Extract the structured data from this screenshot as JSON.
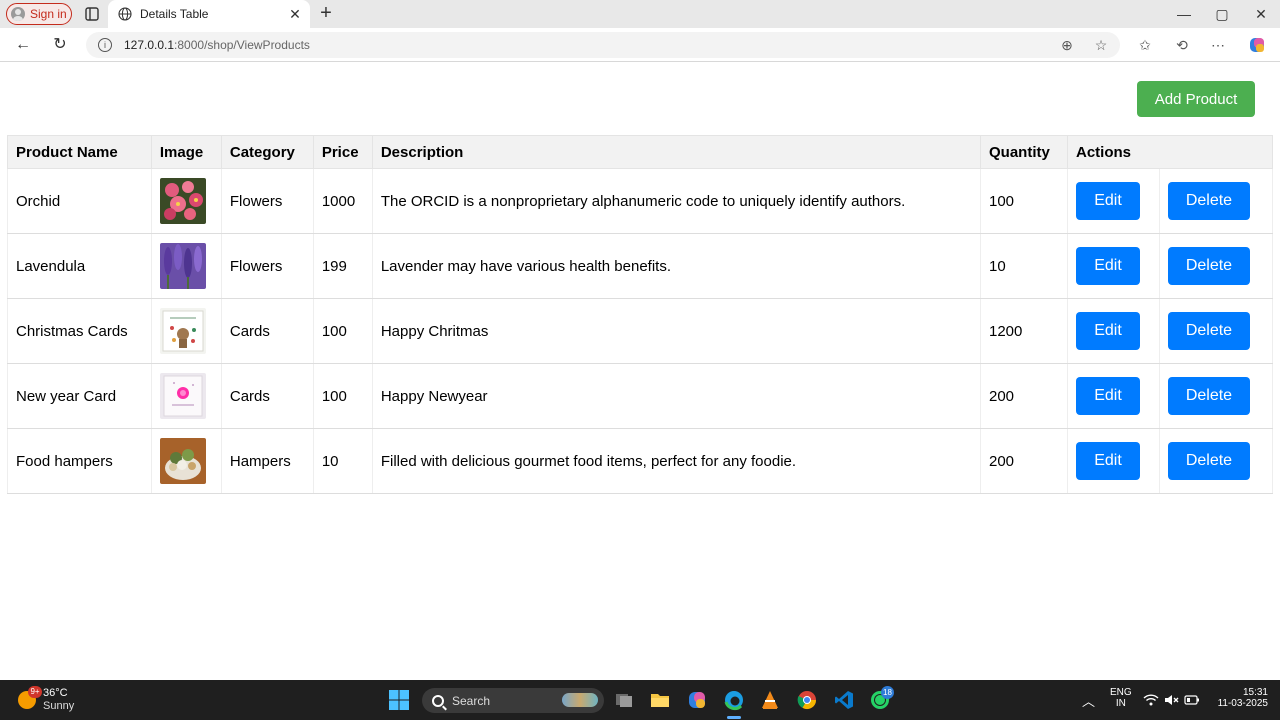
{
  "browser": {
    "signin_label": "Sign in",
    "tab_title": "Details Table",
    "url_host": "127.0.0.1",
    "url_path": ":8000/shop/ViewProducts"
  },
  "page": {
    "add_button_label": "Add Product",
    "table": {
      "headers": {
        "name": "Product Name",
        "image": "Image",
        "category": "Category",
        "price": "Price",
        "description": "Description",
        "quantity": "Quantity",
        "actions": "Actions"
      },
      "edit_label": "Edit",
      "delete_label": "Delete",
      "rows": [
        {
          "name": "Orchid",
          "image_icon": "orchid-flower-photo",
          "category": "Flowers",
          "price": "1000",
          "description": "The ORCID is a nonproprietary alphanumeric code to uniquely identify authors.",
          "quantity": "100"
        },
        {
          "name": "Lavendula",
          "image_icon": "lavender-flower-photo",
          "category": "Flowers",
          "price": "199",
          "description": "Lavender may have various health benefits.",
          "quantity": "10"
        },
        {
          "name": "Christmas Cards",
          "image_icon": "christmas-card-photo",
          "category": "Cards",
          "price": "100",
          "description": "Happy Chritmas",
          "quantity": "1200"
        },
        {
          "name": "New year Card",
          "image_icon": "new-year-card-photo",
          "category": "Cards",
          "price": "100",
          "description": "Happy Newyear",
          "quantity": "200"
        },
        {
          "name": "Food hampers",
          "image_icon": "food-hamper-photo",
          "category": "Hampers",
          "price": "10",
          "description": "Filled with delicious gourmet food items, perfect for any foodie.",
          "quantity": "200"
        }
      ]
    }
  },
  "taskbar": {
    "weather_badge": "9+",
    "weather_temp": "36°C",
    "weather_desc": "Sunny",
    "search_placeholder": "Search",
    "whatsapp_badge": "18",
    "lang_line1": "ENG",
    "lang_line2": "IN",
    "time": "15:31",
    "date": "11-03-2025"
  },
  "colors": {
    "add_button": "#4caf50",
    "action_button": "#007bff",
    "header_bg": "#f2f2f2",
    "taskbar_bg": "#1f1f1f"
  }
}
